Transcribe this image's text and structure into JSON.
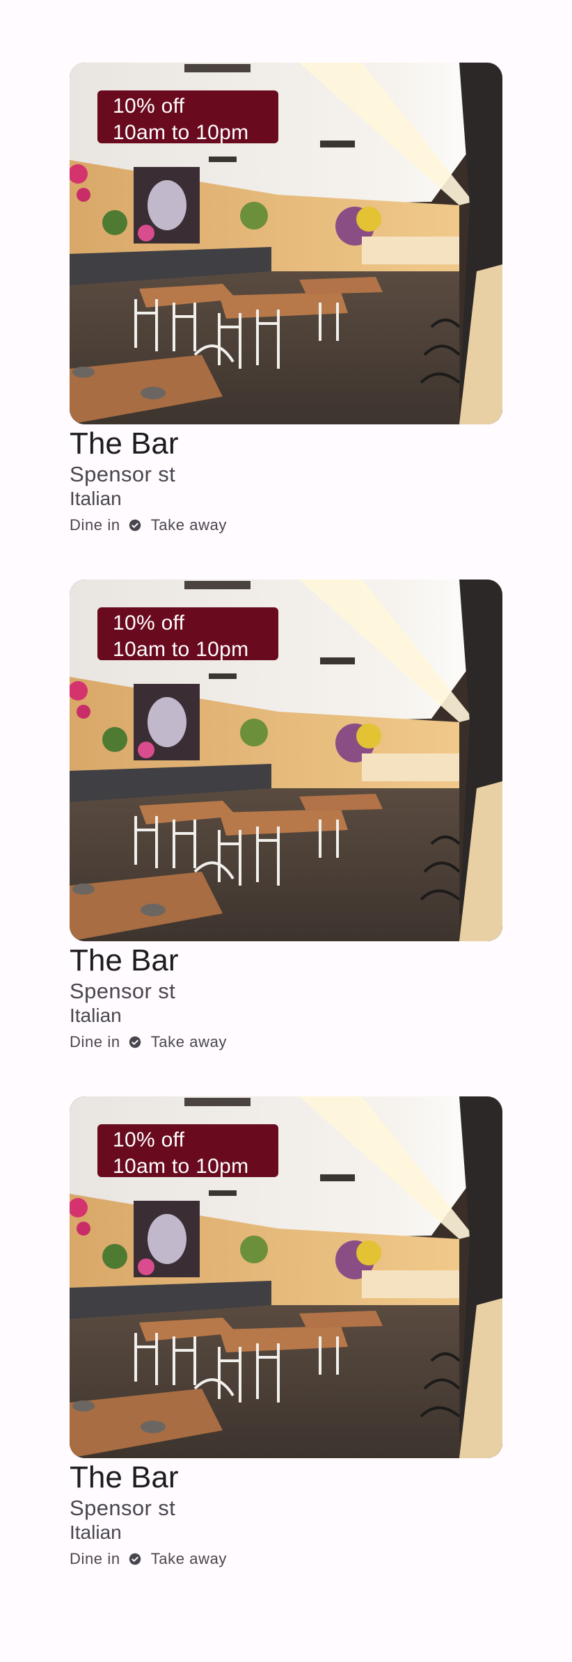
{
  "restaurants": [
    {
      "offer": {
        "discount": "10% off",
        "hours": "10am to 10pm"
      },
      "name": "The Bar",
      "street": "Spensor st",
      "cuisine": "Italian",
      "services": [
        "Dine in",
        "Take away"
      ]
    },
    {
      "offer": {
        "discount": "10% off",
        "hours": "10am to 10pm"
      },
      "name": "The Bar",
      "street": "Spensor st",
      "cuisine": "Italian",
      "services": [
        "Dine in",
        "Take away"
      ]
    },
    {
      "offer": {
        "discount": "10% off",
        "hours": "10am to 10pm"
      },
      "name": "The Bar",
      "street": "Spensor st",
      "cuisine": "Italian",
      "services": [
        "Dine in",
        "Take away"
      ]
    }
  ],
  "colors": {
    "background": "#fffbfe",
    "offer_badge": "#690a1e",
    "title_text": "#1c1b1f",
    "secondary_text": "#49454f"
  },
  "icons": {
    "service_separator": "check-circle-icon"
  }
}
